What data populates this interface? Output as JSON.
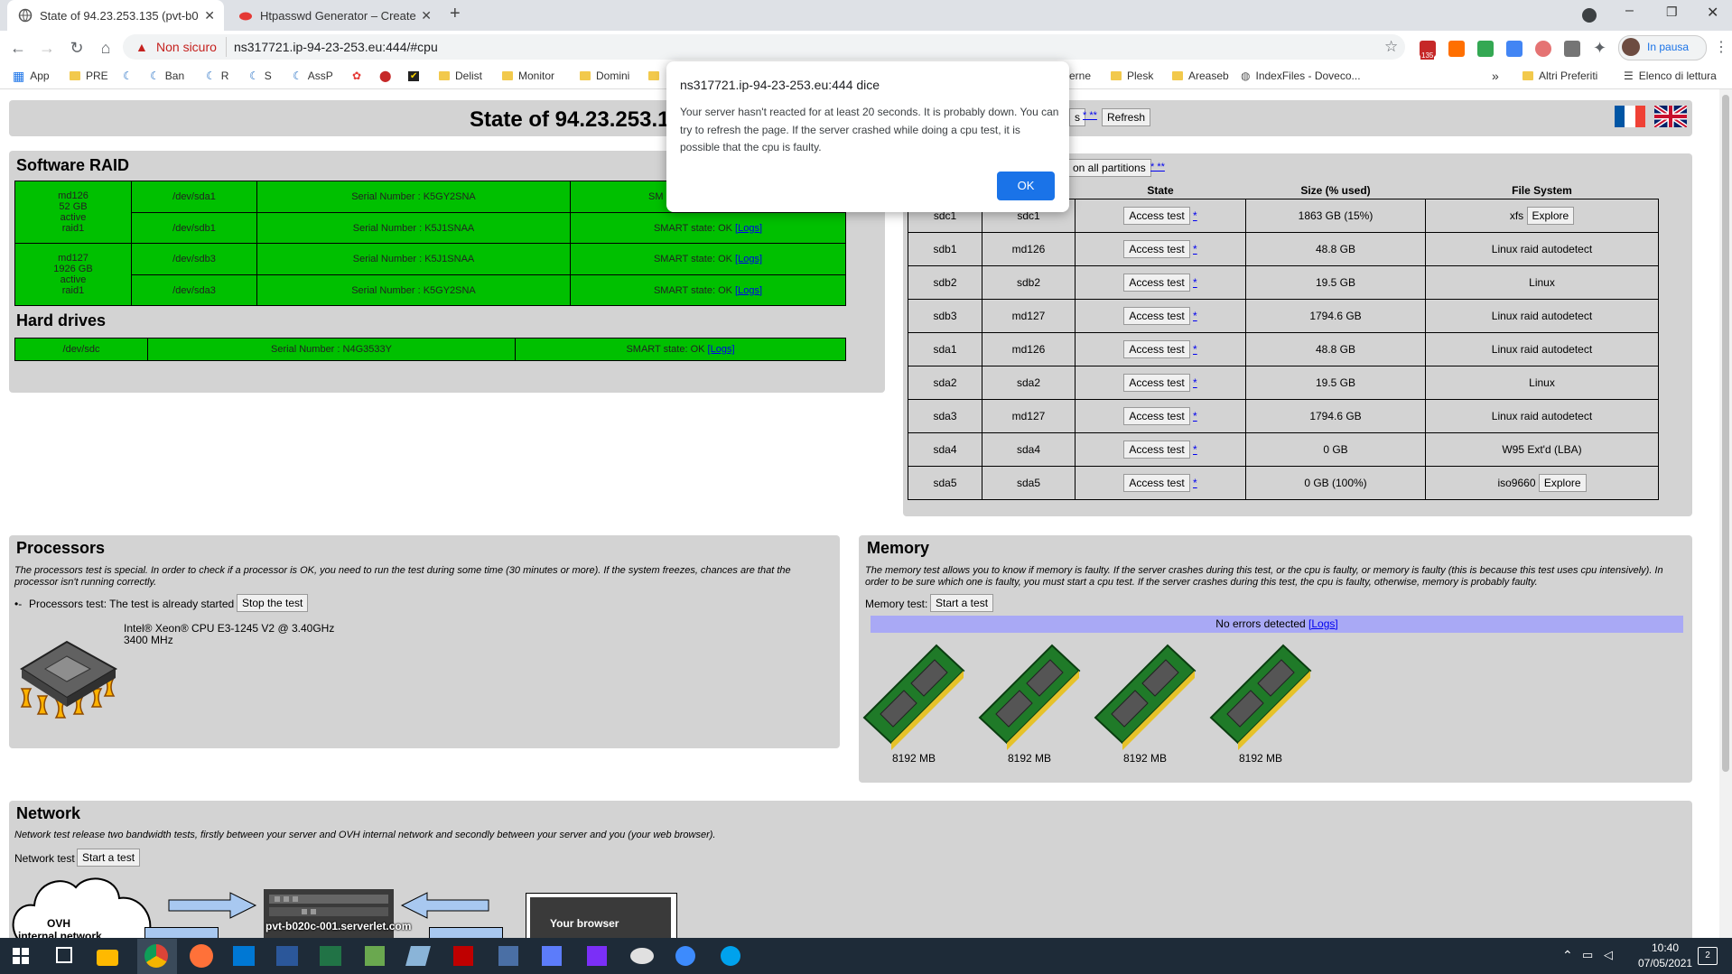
{
  "browser": {
    "tabs": [
      {
        "title": "State of 94.23.253.135 (pvt-b020",
        "active": true
      },
      {
        "title": "Htpasswd Generator – Create htp",
        "active": false
      }
    ],
    "new_tab": "+",
    "security_label": "Non sicuro",
    "url": "ns317721.ip-94-23-253.eu:444/#cpu",
    "profile_label": "In pausa",
    "extension_badge": "135",
    "bookmarks": [
      "App",
      "PRE",
      "Ban",
      "R",
      "S",
      "AssP",
      "Delist",
      "Monitor",
      "Domini",
      "erne",
      "Plesk",
      "Areaseb",
      "IndexFiles - Doveco...",
      "Altri Preferiti",
      "Elenco di lettura"
    ],
    "bookmarks_more": "»"
  },
  "page": {
    "title": "State of 94.23.253.1",
    "top_buttons": {
      "partial": "s",
      "help": "* **",
      "refresh": "Refresh"
    },
    "software_raid": {
      "title": "Software RAID",
      "arrays": [
        {
          "name": "md126",
          "size": "52 GB",
          "status": "active",
          "level": "raid1",
          "rows": [
            {
              "dev": "/dev/sda1",
              "serial": "Serial Number : K5GY2SNA",
              "smart": "SM"
            },
            {
              "dev": "/dev/sdb1",
              "serial": "Serial Number : K5J1SNAA",
              "smart": "SMART state: OK",
              "logs": "[Logs]"
            }
          ]
        },
        {
          "name": "md127",
          "size": "1926 GB",
          "status": "active",
          "level": "raid1",
          "rows": [
            {
              "dev": "/dev/sdb3",
              "serial": "Serial Number : K5J1SNAA",
              "smart": "SMART state: OK",
              "logs": "[Logs]"
            },
            {
              "dev": "/dev/sda3",
              "serial": "Serial Number : K5GY2SNA",
              "smart": "SMART state: OK",
              "logs": "[Logs]"
            }
          ]
        }
      ]
    },
    "hard_drives": {
      "title": "Hard drives",
      "rows": [
        {
          "dev": "/dev/sdc",
          "serial": "Serial Number : N4G3533Y",
          "smart": "SMART state: OK",
          "logs": "[Logs]"
        }
      ]
    },
    "partitions": {
      "test_all_label": "on all partitions",
      "test_all_help": "* **",
      "headers": {
        "state": "State",
        "size": "Size (% used)",
        "fs": "File System"
      },
      "rows": [
        {
          "part": "sdc1",
          "device": "sdc1",
          "action": "Access test",
          "help": "*",
          "size": "1863 GB (15%)",
          "fs": "xfs",
          "explore": "Explore"
        },
        {
          "part": "sdb1",
          "device": "md126",
          "action": "Access test",
          "help": "*",
          "size": "48.8 GB",
          "fs": "Linux raid autodetect"
        },
        {
          "part": "sdb2",
          "device": "sdb2",
          "action": "Access test",
          "help": "*",
          "size": "19.5 GB",
          "fs": "Linux"
        },
        {
          "part": "sdb3",
          "device": "md127",
          "action": "Access test",
          "help": "*",
          "size": "1794.6 GB",
          "fs": "Linux raid autodetect"
        },
        {
          "part": "sda1",
          "device": "md126",
          "action": "Access test",
          "help": "*",
          "size": "48.8 GB",
          "fs": "Linux raid autodetect"
        },
        {
          "part": "sda2",
          "device": "sda2",
          "action": "Access test",
          "help": "*",
          "size": "19.5 GB",
          "fs": "Linux"
        },
        {
          "part": "sda3",
          "device": "md127",
          "action": "Access test",
          "help": "*",
          "size": "1794.6 GB",
          "fs": "Linux raid autodetect"
        },
        {
          "part": "sda4",
          "device": "sda4",
          "action": "Access test",
          "help": "*",
          "size": "0 GB",
          "fs": "W95 Ext'd (LBA)"
        },
        {
          "part": "sda5",
          "device": "sda5",
          "action": "Access test",
          "help": "*",
          "size": "0 GB (100%)",
          "fs": "iso9660",
          "explore": "Explore"
        }
      ]
    },
    "processors": {
      "title": "Processors",
      "note": "The processors test is special. In order to check if a processor is OK, you need to run the test during some time (30 minutes or more). If the system freezes, chances are that the processor isn't running correctly.",
      "spinner": "•-",
      "test_label": "Processors test: The test is already started",
      "stop_button": "Stop the test",
      "cpu_model": "Intel® Xeon® CPU E3-1245 V2 @ 3.40GHz",
      "cpu_freq": "3400 MHz"
    },
    "memory": {
      "title": "Memory",
      "note": "The memory test allows you to know if memory is faulty. If the server crashes during this test, or the cpu is faulty, or memory is faulty (this is because this test uses cpu intensively). In order to be sure which one is faulty, you must start a cpu test. If the server crashes during this test, the cpu is faulty, otherwise, memory is probably faulty.",
      "test_label": "Memory test:",
      "start_button": "Start a test",
      "status": "No errors detected",
      "logs": "[Logs]",
      "modules": [
        "8192 MB",
        "8192 MB",
        "8192 MB",
        "8192 MB"
      ]
    },
    "network": {
      "title": "Network",
      "note": "Network test release two bandwidth tests, firstly between your server and OVH internal network and secondly between your server and you (your web browser).",
      "test_label": "Network test",
      "start_button": "Start a test",
      "cloud_label_1": "OVH",
      "cloud_label_2": "internal network",
      "server_label": "pvt-b020c-001.serverlet.com",
      "browser_label": "Your browser"
    }
  },
  "dialog": {
    "title": "ns317721.ip-94-23-253.eu:444 dice",
    "message": "Your server hasn't reacted for at least 20 seconds. It is probably down. You can try to refresh the page. If the server crashed while doing a cpu test, it is possible that the cpu is faulty.",
    "ok": "OK"
  },
  "taskbar": {
    "time": "10:40",
    "date": "07/05/2021",
    "notifications": "2"
  }
}
